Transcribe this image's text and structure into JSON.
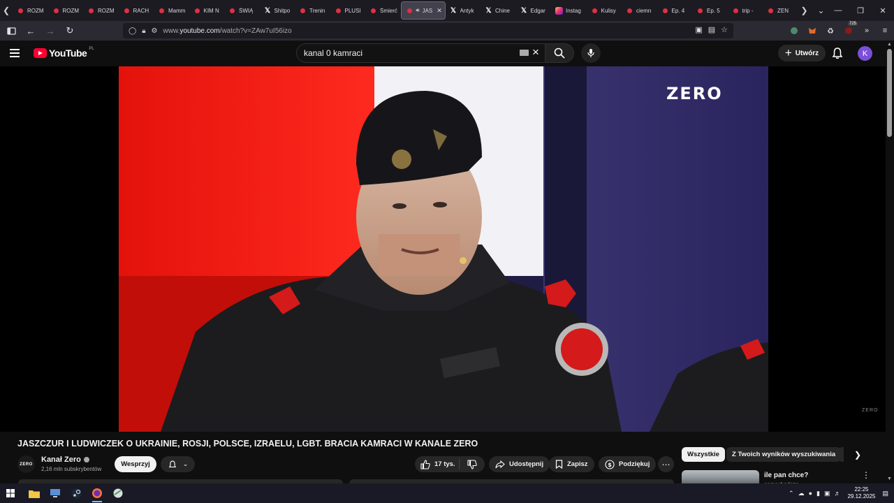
{
  "browser": {
    "tabs": [
      {
        "label": "ROZM",
        "icon": "youtube-icon",
        "active": false
      },
      {
        "label": "ROZM",
        "icon": "youtube-icon",
        "active": false
      },
      {
        "label": "ROZM",
        "icon": "youtube-icon",
        "active": false
      },
      {
        "label": "RACH",
        "icon": "youtube-icon",
        "active": false
      },
      {
        "label": "Mamm",
        "icon": "youtube-icon",
        "active": false
      },
      {
        "label": "KIM N",
        "icon": "youtube-icon",
        "active": false
      },
      {
        "label": "ŚWIĄ",
        "icon": "youtube-icon",
        "active": false
      },
      {
        "label": "Shitpo",
        "icon": "x-icon",
        "active": false
      },
      {
        "label": "Trenin",
        "icon": "youtube-icon",
        "active": false
      },
      {
        "label": "PLUSI",
        "icon": "youtube-icon",
        "active": false
      },
      {
        "label": "Śmierć",
        "icon": "youtube-icon",
        "active": false
      },
      {
        "label": "JAS",
        "icon": "youtube-icon",
        "active": true
      },
      {
        "label": "Antyk",
        "icon": "x-icon",
        "active": false
      },
      {
        "label": "Chine",
        "icon": "x-icon",
        "active": false
      },
      {
        "label": "Edgar",
        "icon": "x-icon",
        "active": false
      },
      {
        "label": "Instag",
        "icon": "instagram-icon",
        "active": false
      },
      {
        "label": "Kulisy",
        "icon": "youtube-icon",
        "active": false
      },
      {
        "label": "ciemn",
        "icon": "youtube-icon",
        "active": false
      },
      {
        "label": "Ep. 4",
        "icon": "youtube-icon",
        "active": false
      },
      {
        "label": "Ep. 5",
        "icon": "youtube-icon",
        "active": false
      },
      {
        "label": "trip - ",
        "icon": "youtube-icon",
        "active": false
      },
      {
        "label": "ZEN",
        "icon": "youtube-icon",
        "active": false
      }
    ],
    "url_prefix": "www.",
    "url_domain": "youtube.com",
    "url_path": "/watch?v=ZAw7uI56izo",
    "extension_badge": "725"
  },
  "youtube": {
    "logo_word": "YouTube",
    "region": "PL",
    "search_query": "kanal 0 kamraci",
    "create_label": "Utwórz",
    "avatar_letter": "K"
  },
  "video": {
    "overlay_logo": "ZERO",
    "watermark": "ZERO",
    "title": "JASZCZUR I LUDWICZEK O UKRAINIE, ROSJI, POLSCE, IZRAELU, LGBT. BRACIA KAMRACI W KANALE ZERO",
    "channel_name": "Kanał Zero",
    "channel_avatar_text": "ZERO",
    "subscribers": "2,16 mln subskrybentów",
    "support_label": "Wesprzyj",
    "likes": "17 tys.",
    "share_label": "Udostępnij",
    "save_label": "Zapisz",
    "thanks_label": "Podziękuj"
  },
  "sidebar": {
    "chips": [
      "Wszystkie",
      "Z Twoich wyników wyszukiwania"
    ],
    "recommendation_title": "ile pan chce?",
    "recommendation_channel": "samochodoza"
  },
  "taskbar": {
    "time": "22:25",
    "date": "29.12.2025"
  },
  "colors": {
    "youtube_red": "#ff0033",
    "background": "#0f0f0f",
    "avatar": "#7b4fd6"
  }
}
